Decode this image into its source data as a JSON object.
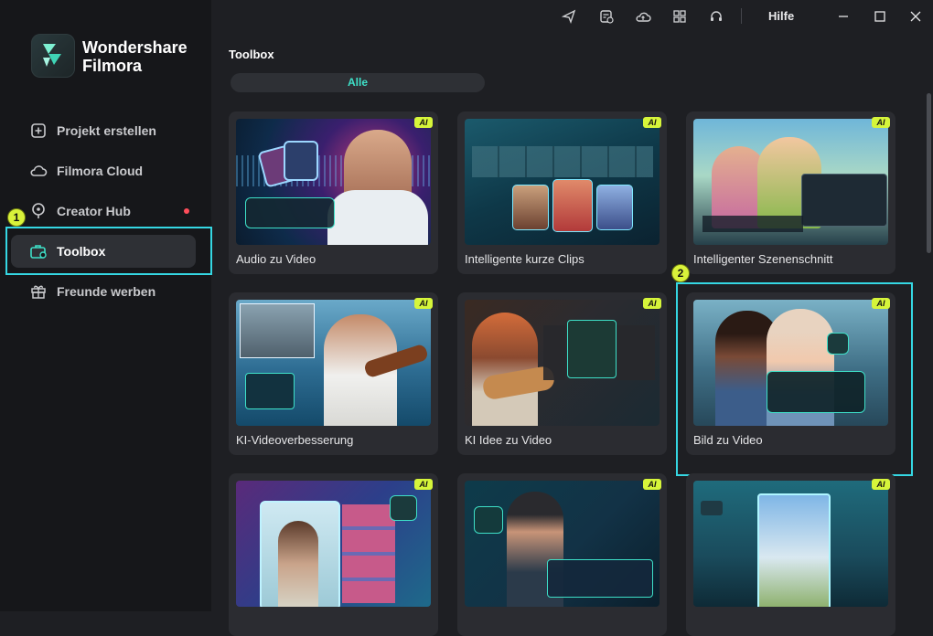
{
  "app": {
    "brand_line1": "Wondershare",
    "brand_line2": "Filmora"
  },
  "sidebar": {
    "items": [
      {
        "label": "Projekt erstellen",
        "icon": "plus-square-icon"
      },
      {
        "label": "Filmora Cloud",
        "icon": "cloud-icon"
      },
      {
        "label": "Creator Hub",
        "icon": "bulb-icon"
      },
      {
        "label": "Toolbox",
        "icon": "toolbox-icon"
      },
      {
        "label": "Freunde werben",
        "icon": "gift-icon"
      }
    ],
    "active": "Toolbox"
  },
  "topbar": {
    "help_label": "Hilfe"
  },
  "main": {
    "title": "Toolbox",
    "filter_label": "Alle",
    "cards": [
      {
        "label": "Audio zu Video",
        "ai": "AI"
      },
      {
        "label": "Intelligente kurze Clips",
        "ai": "AI"
      },
      {
        "label": "Intelligenter Szenenschnitt",
        "ai": "AI"
      },
      {
        "label": "KI-Videoverbesserung",
        "ai": "AI"
      },
      {
        "label": "KI Idee zu Video",
        "ai": "AI"
      },
      {
        "label": "Bild zu Video",
        "ai": "AI"
      },
      {
        "label": "",
        "ai": "AI"
      },
      {
        "label": "",
        "ai": "AI"
      },
      {
        "label": "",
        "ai": "AI"
      }
    ]
  },
  "annotations": {
    "badge1": "1",
    "badge2": "2"
  },
  "colors": {
    "accent": "#35d7e3",
    "ai_badge": "#d6f53a",
    "notify_dot": "#ff4d5a",
    "filter_text": "#3ee0c8"
  }
}
